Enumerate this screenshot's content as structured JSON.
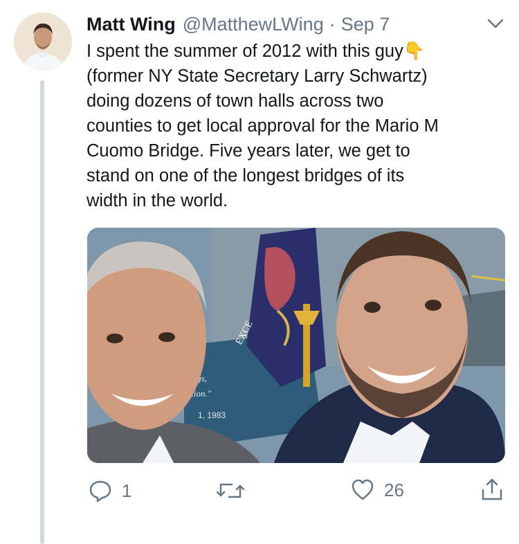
{
  "tweet": {
    "author": {
      "display_name": "Matt Wing",
      "handle": "@MatthewLWing"
    },
    "date": "Sep 7",
    "text": "I spent the summer of 2012 with this guy👇\n(former NY State Secretary Larry Schwartz)\ndoing dozens of town halls across two\ncounties to get local approval for the Mario M\nCuomo Bridge. Five years later, we get to\nstand on one of the longest bridges of its\nwidth in the world.",
    "media": {
      "sign_text": [
        "ings,",
        "iation.\"",
        "1, 1983"
      ],
      "flag_text": "EXCE"
    },
    "actions": {
      "reply_count": "1",
      "like_count": "26"
    }
  },
  "colors": {
    "text": "#14171a",
    "secondary": "#657786",
    "thread_line": "#cfd9de"
  }
}
